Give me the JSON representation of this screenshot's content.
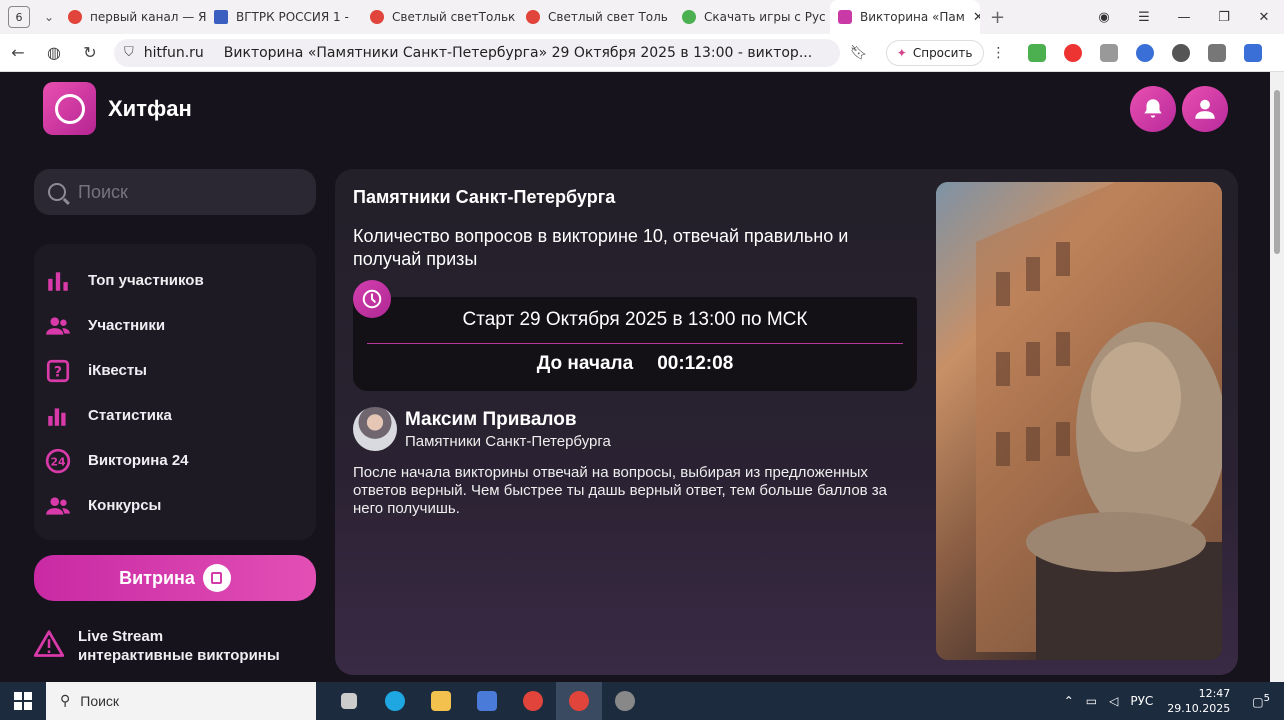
{
  "browser": {
    "tab_count": "6",
    "tabs": [
      {
        "label": "первый канал — Ян",
        "color": "#e0443a"
      },
      {
        "label": "ВГТРК РОССИЯ 1 -",
        "color": "#3b5fc0"
      },
      {
        "label": "Светлый светТольк",
        "color": "#e0443a"
      },
      {
        "label": "Светлый свет Толь",
        "color": "#e0443a"
      },
      {
        "label": "Скачать игры с Рус",
        "color": "#4caf50"
      },
      {
        "label": "Викторина «Пам",
        "color": "#c93aa6"
      }
    ],
    "url_domain": "hitfun.ru",
    "page_title": "Викторина «Памятники Санкт-Петербурга» 29 Октября 2025 в 13:00 - виктор...",
    "ask_button": "Спросить"
  },
  "site": {
    "brand": "Хитфан",
    "accent_color": "#d93aaa",
    "search_placeholder": "Поиск",
    "menu": [
      {
        "label": "Топ участников",
        "icon": "bar-chart-icon"
      },
      {
        "label": "Участники",
        "icon": "users-icon"
      },
      {
        "label": "iКвесты",
        "icon": "question-icon"
      },
      {
        "label": "Статистика",
        "icon": "stats-icon"
      },
      {
        "label": "Викторина 24",
        "icon": "24-icon"
      },
      {
        "label": "Конкурсы",
        "icon": "users-icon"
      }
    ],
    "showcase_button": "Витрина",
    "live_stream": {
      "title": "Live Stream",
      "subtitle": "интерактивные викторины"
    }
  },
  "quiz": {
    "title": "Памятники Санкт-Петербурга",
    "description": "Количество вопросов в викторине 10, отвечай правильно и получай призы",
    "start_text": "Старт 29 Октября 2025 в 13:00 по МСК",
    "countdown_label": "До начала",
    "countdown_value": "00:12:08",
    "author_name": "Максим Привалов",
    "author_subtitle": "Памятники Санкт-Петербурга",
    "rules": "После начала викторины отвечай на вопросы, выбирая из предложенных ответов верный. Чем быстрее ты дашь верный ответ, тем больше баллов за него получишь."
  },
  "taskbar": {
    "search_label": "Поиск",
    "language": "РУС",
    "time": "12:47",
    "date": "29.10.2025",
    "notifications": "5"
  }
}
